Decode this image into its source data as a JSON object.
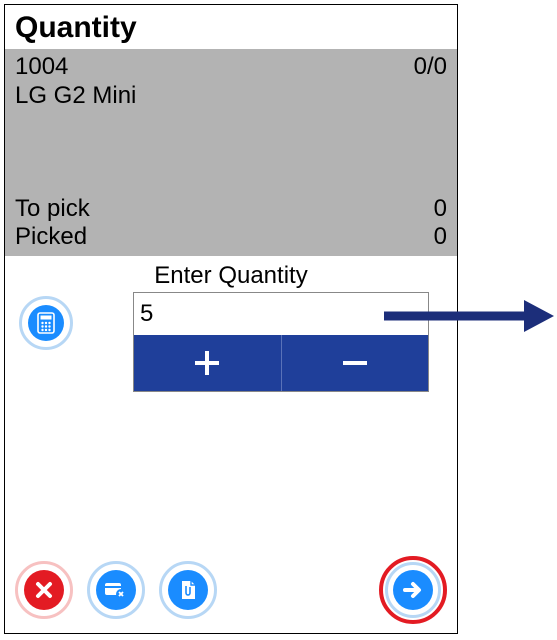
{
  "title": "Quantity",
  "item": {
    "code": "1004",
    "counter": "0/0",
    "name": "LG G2 Mini"
  },
  "stats": {
    "to_pick_label": "To pick",
    "to_pick_value": "0",
    "picked_label": "Picked",
    "picked_value": "0"
  },
  "entry": {
    "label": "Enter Quantity",
    "value": "5"
  },
  "icons": {
    "calculator": "calculator-icon",
    "plus": "plus-icon",
    "minus": "minus-icon",
    "cancel": "x-icon",
    "discard": "card-x-icon",
    "attachment": "document-clip-icon",
    "proceed": "arrow-right-icon"
  },
  "colors": {
    "accent_blue": "#1a8cff",
    "deep_blue": "#1f3f9a",
    "red": "#e31b23",
    "grey_block": "#b3b3b3",
    "arrow": "#1c2e7a"
  }
}
